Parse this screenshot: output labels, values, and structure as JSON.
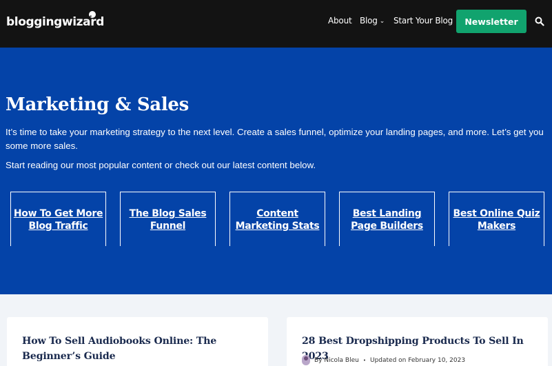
{
  "header": {
    "logo": "bloggingwizard",
    "nav": [
      {
        "label": "About",
        "has_dropdown": false
      },
      {
        "label": "Blog",
        "has_dropdown": true
      },
      {
        "label": "Start Your Blog",
        "has_dropdown": false
      }
    ],
    "newsletter_label": "Newsletter",
    "search_icon": "search-icon"
  },
  "hero": {
    "title": "Marketing & Sales",
    "description": "It’s time to take your marketing strategy to the next level. Create a sales funnel, optimize your landing pages, and more. Let’s get you some more sales.",
    "subtext": "Start reading our most popular content or check out our latest content below.",
    "tiles": [
      {
        "label": "How To Get More Blog Traffic"
      },
      {
        "label": "The Blog Sales Funnel"
      },
      {
        "label": "Content Marketing Stats"
      },
      {
        "label": "Best Landing Page Builders"
      },
      {
        "label": "Best Online Quiz Makers"
      }
    ]
  },
  "cards": [
    {
      "title": "How To Sell Audiobooks Online: The Beginner’s Guide"
    },
    {
      "title": "28 Best Dropshipping Products To Sell In 2023",
      "author": "By Nicola Bleu",
      "separator": "•",
      "updated": "Updated on February 10, 2023"
    }
  ],
  "colors": {
    "header_bg": "#131313",
    "hero_bg": "#0443a8",
    "accent": "#11a36e",
    "page_bg": "#f1f4f8"
  }
}
